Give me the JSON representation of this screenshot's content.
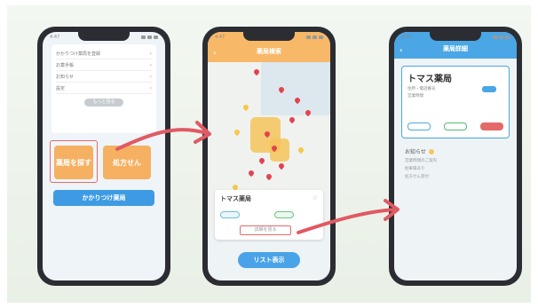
{
  "caption": "",
  "colors": {
    "accent_orange": "#f7b868",
    "accent_blue": "#4aa6e4",
    "highlight_red": "#e46a6a",
    "arrow": "#e05a63"
  },
  "phone1": {
    "time": "4:47",
    "list_rows": [
      {
        "text": "かかりつけ薬局を登録"
      },
      {
        "text": "お薬手帳"
      },
      {
        "text": "お知らせ"
      },
      {
        "text": "設定"
      }
    ],
    "more_label": "もっと見る",
    "btn_left_label": "薬局を探す",
    "btn_right_label": "処方せん",
    "btn_wide_label": "かかりつけ薬局"
  },
  "phone2": {
    "time": "4:47",
    "header_title": "薬局検索",
    "popup_title": "トマス薬局",
    "detail_label": "詳細を見る",
    "list_button_label": "リスト表示"
  },
  "phone3": {
    "time": "4:47",
    "header_title": "薬局詳細",
    "card_title": "トマス薬局",
    "card_lines": [
      "住所・電話番号",
      "営業時間"
    ],
    "info_heading": "お知らせ",
    "info_lines": [
      "営業時間のご案内",
      "駐車場あり",
      "処方せん受付"
    ]
  }
}
